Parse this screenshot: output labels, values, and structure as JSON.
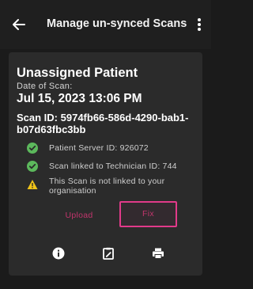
{
  "appbar": {
    "title": "Manage un-synced Scans",
    "back_icon": "arrow-left-icon",
    "menu_icon": "more-vertical-icon"
  },
  "card": {
    "heading": "Unassigned Patient",
    "date_label": "Date of Scan:",
    "date_value": "Jul 15, 2023 13:06 PM",
    "scan_id": "Scan ID: 5974fb66-586d-4290-bab1-b07d63fbc3bb",
    "statuses": [
      {
        "icon": "check-circle-icon",
        "color": "#5cb85c",
        "text": "Patient Server ID: 926072"
      },
      {
        "icon": "check-circle-icon",
        "color": "#5cb85c",
        "text": "Scan linked to Technician ID: 744"
      },
      {
        "icon": "warning-triangle-icon",
        "color": "#f0c419",
        "text": "This Scan is not linked to your organisation"
      }
    ],
    "actions": {
      "upload_label": "Upload",
      "fix_label": "Fix"
    },
    "bottom_icons": [
      "info-icon",
      "clipboard-edit-icon",
      "print-icon"
    ]
  },
  "colors": {
    "background": "#1b1b1b",
    "card": "#2b2b2b",
    "accent": "#e23a8a",
    "success": "#5cb85c",
    "warning": "#f0c419"
  }
}
